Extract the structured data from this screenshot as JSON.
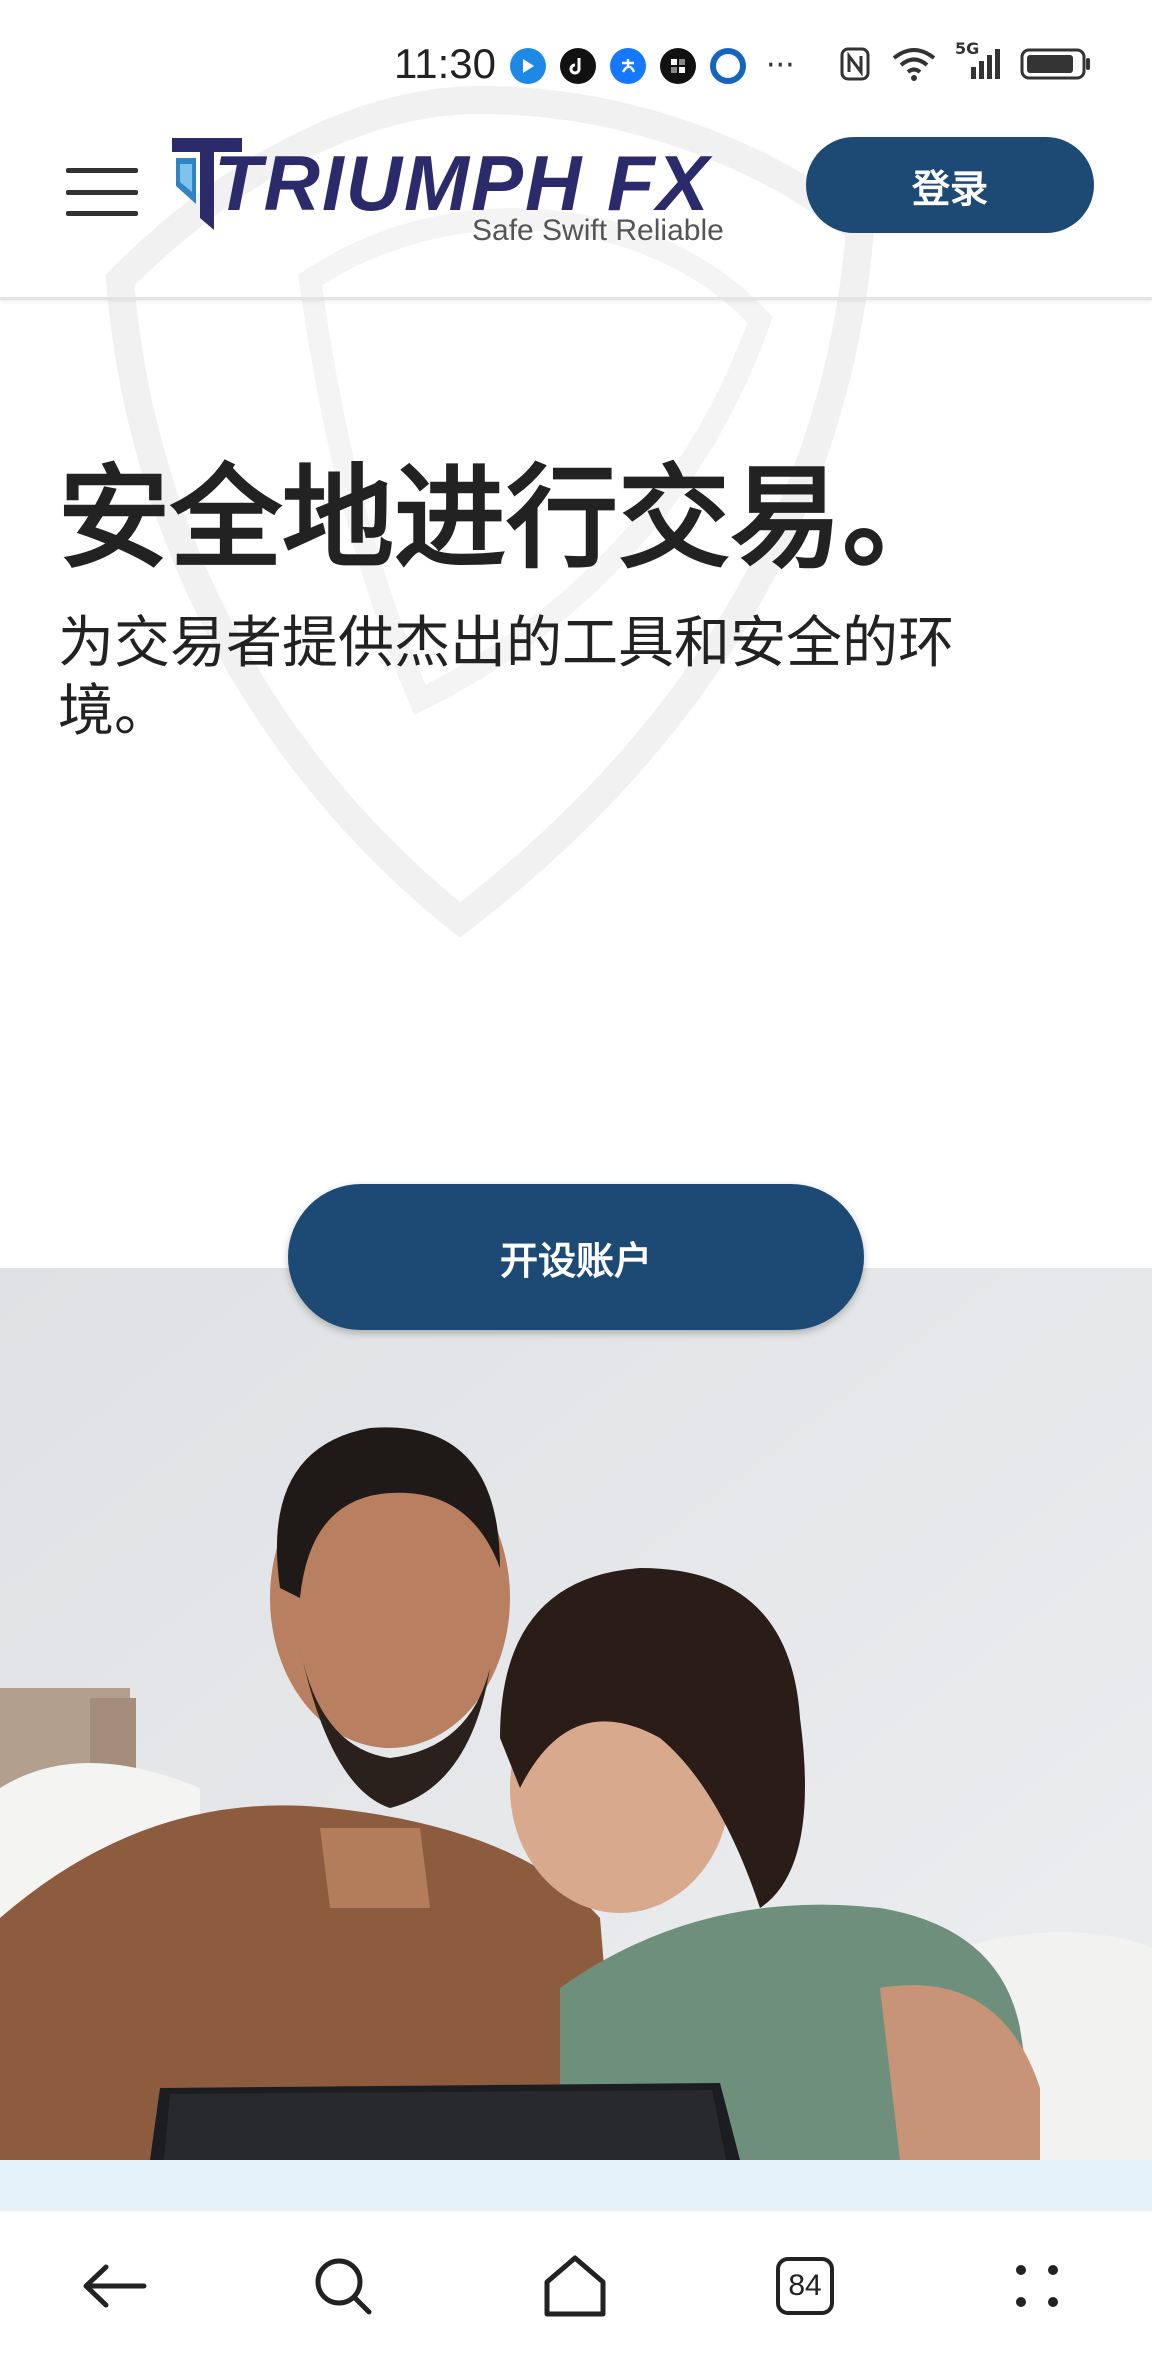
{
  "status_bar": {
    "time": "11:30",
    "more": "···",
    "network": "5G",
    "app_icons": [
      "bluetooth-app-icon",
      "tiktok-icon",
      "alipay-icon",
      "app-grid-icon",
      "circle-app-icon"
    ],
    "system_icons": [
      "nfc-icon",
      "wifi-icon",
      "cellular-signal-icon",
      "battery-icon"
    ]
  },
  "header": {
    "brand_name": "TRIUMPH FX",
    "tagline": "Safe Swift Reliable",
    "login_label": "登录"
  },
  "hero": {
    "title": "安全地进行交易。",
    "subtitle": "为交易者提供杰出的工具和安全的环境。",
    "cta_label": "开设账户"
  },
  "bottom_nav": {
    "tab_count": "84",
    "items": [
      "back-arrow-icon",
      "search-icon",
      "home-icon",
      "tabs-icon",
      "more-icon"
    ]
  },
  "colors": {
    "primary": "#1d4a75",
    "logo_text": "#2b2a6b",
    "logo_blue": "#2f84c4",
    "strip": "#e6f2f9"
  }
}
